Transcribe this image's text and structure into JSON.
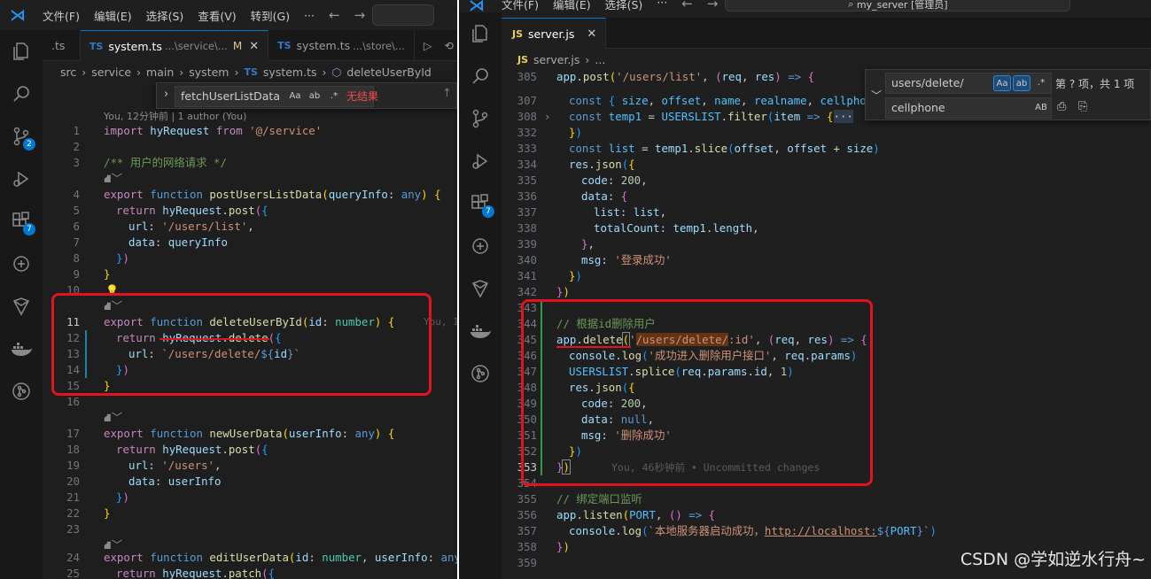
{
  "left": {
    "menu": [
      "文件(F)",
      "编辑(E)",
      "选择(S)",
      "查看(V)",
      "转到(G)",
      "···"
    ],
    "tabs": [
      {
        "label": ".ts",
        "desc": "",
        "mod": ""
      },
      {
        "label": "system.ts",
        "desc": "...\\service\\...",
        "mod": "M"
      },
      {
        "label": "system.ts",
        "desc": "...\\store\\...",
        "mod": ""
      }
    ],
    "breadcrumb": [
      "src",
      "service",
      "main",
      "system",
      "system.ts",
      "deleteUserById"
    ],
    "find": {
      "value": "fetchUserListData",
      "result": "无结果"
    },
    "blame": "You, 12分钟前 | 1 author (You)",
    "ghost_blame": "You, 1",
    "activity_badges": {
      "scm": "2",
      "ext": "7"
    }
  },
  "right": {
    "menu": [
      "文件(F)",
      "编辑(E)",
      "选择(S)",
      "···"
    ],
    "title_search": "my_server [管理员]",
    "tab": {
      "label": "server.js"
    },
    "breadcrumb": [
      "server.js",
      "..."
    ],
    "find": {
      "value": "users/delete/",
      "replace": "cellphone",
      "count": "第 ? 项，共 1 项",
      "opts": [
        "Aa",
        "ab",
        ".*"
      ],
      "ab": "AB"
    },
    "activity_badges": {
      "ext": "7"
    },
    "inline_blame": "You, 46秒钟前 • Uncommitted changes"
  },
  "watermark": "CSDN @学如逆水行舟~"
}
